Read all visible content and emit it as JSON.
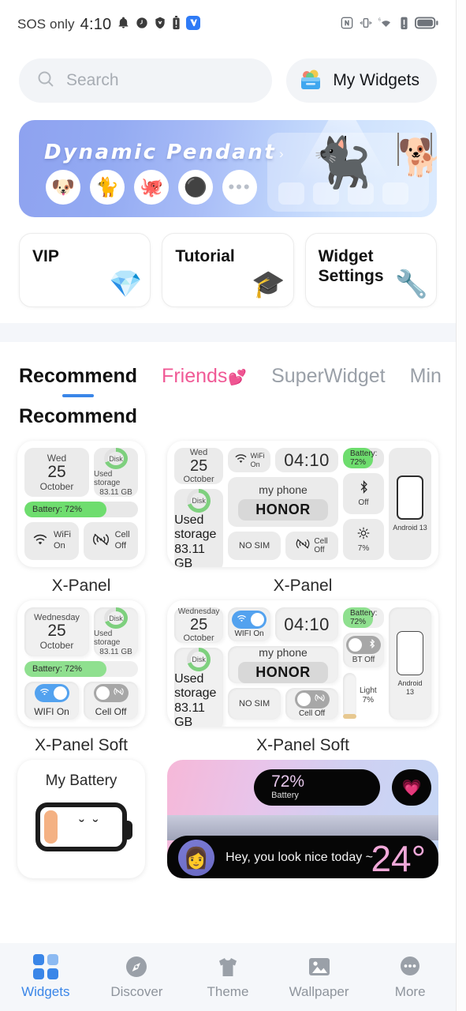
{
  "status_bar": {
    "carrier": "SOS only",
    "time": "4:10",
    "left_icons": [
      "bell-icon",
      "clock-badge-icon",
      "shield-x-icon",
      "battery-alert-icon",
      "app-blue-icon"
    ],
    "right_icons": [
      "nfc-icon",
      "vibrate-icon",
      "wifi-6-icon",
      "alert-icon",
      "battery-icon"
    ]
  },
  "search": {
    "placeholder": "Search",
    "icon": "search-icon"
  },
  "my_widgets": {
    "label": "My Widgets",
    "icon": "widgets-box-icon"
  },
  "banner": {
    "title": "Dynamic  Pendant",
    "arrow": "›",
    "avatars": [
      "shiba-avatar",
      "black-cat-avatar",
      "octopus-avatar",
      "coffee-avatar",
      "more-dots"
    ],
    "avatar_glyphs": [
      "🐶",
      "🐈",
      "🐙",
      "⚫",
      "•••"
    ],
    "pendant_cat": "🐈‍⬛",
    "pendant_dog": "🐕"
  },
  "quick_cards": [
    {
      "title": "VIP",
      "icon": "gem-icon",
      "glyph": "💎"
    },
    {
      "title": "Tutorial",
      "icon": "graduation-cap-icon",
      "glyph": "🎓"
    },
    {
      "title": "Widget Settings",
      "icon": "wrench-icon",
      "glyph": "🔧"
    }
  ],
  "tabs": [
    {
      "label": "Recommend",
      "active": true
    },
    {
      "label": "Friends",
      "heart": "💕",
      "active": false
    },
    {
      "label": "SuperWidget",
      "active": false
    },
    {
      "label": "Min",
      "active": false
    }
  ],
  "section_title": "Recommend",
  "widgets": {
    "row1": [
      {
        "label": "X-Panel",
        "size": "small",
        "style": "flat"
      },
      {
        "label": "X-Panel",
        "size": "large",
        "style": "flat"
      }
    ],
    "row2": [
      {
        "label": "X-Panel Soft",
        "size": "small",
        "style": "soft"
      },
      {
        "label": "X-Panel Soft",
        "size": "large",
        "style": "soft"
      }
    ]
  },
  "panel_content": {
    "date_short": {
      "weekday": "Wed",
      "day": "25",
      "month": "October"
    },
    "date_long": {
      "weekday": "Wednesday",
      "day": "25",
      "month": "October"
    },
    "disk": {
      "label": "Disk",
      "line1": "Used storage",
      "line2": "83.11 GB",
      "percent": 70
    },
    "battery": {
      "text": "Battery: 72%",
      "percent": 72
    },
    "wifi": {
      "line1": "WiFi",
      "line2": "On",
      "toggle_label": "WIFI On",
      "state": "on"
    },
    "cell": {
      "line1": "Cell",
      "line2": "Off",
      "toggle_label": "Cell Off",
      "state": "off"
    },
    "clock": "04:10",
    "phone_name": "my phone",
    "brand": "HONOR",
    "sim": "NO SIM",
    "bluetooth": {
      "label": "Off",
      "toggle_label": "BT Off",
      "state": "off"
    },
    "brightness": {
      "label": "7%",
      "name": "Light",
      "percent": 7
    },
    "android": {
      "label": "Android 13",
      "label_l1": "Android",
      "label_l2": "13"
    }
  },
  "row3": {
    "my_battery": {
      "title": "My Battery",
      "face": "˘  ˘",
      "level_percent": 30
    },
    "color_widget": {
      "battery_percent": "72%",
      "battery_label": "Battery",
      "heart_icon": "heart-icon",
      "heart_glyph": "💗",
      "message": "Hey, you look nice today ~",
      "temperature": "24°",
      "avatar": "girl-avatar",
      "avatar_glyph": "👩"
    }
  },
  "bottom_nav": [
    {
      "label": "Widgets",
      "icon": "grid-icon",
      "active": true
    },
    {
      "label": "Discover",
      "icon": "compass-icon",
      "glyph": "🧭",
      "active": false
    },
    {
      "label": "Theme",
      "icon": "tshirt-icon",
      "glyph": "👕",
      "active": false
    },
    {
      "label": "Wallpaper",
      "icon": "image-icon",
      "glyph": "🖼",
      "active": false
    },
    {
      "label": "More",
      "icon": "more-dots-icon",
      "glyph": "•••",
      "active": false
    }
  ],
  "colors": {
    "accent": "#3a86e8",
    "pink": "#f05a96",
    "green": "#6edd6e",
    "nav_bg": "#f5f7fa"
  }
}
